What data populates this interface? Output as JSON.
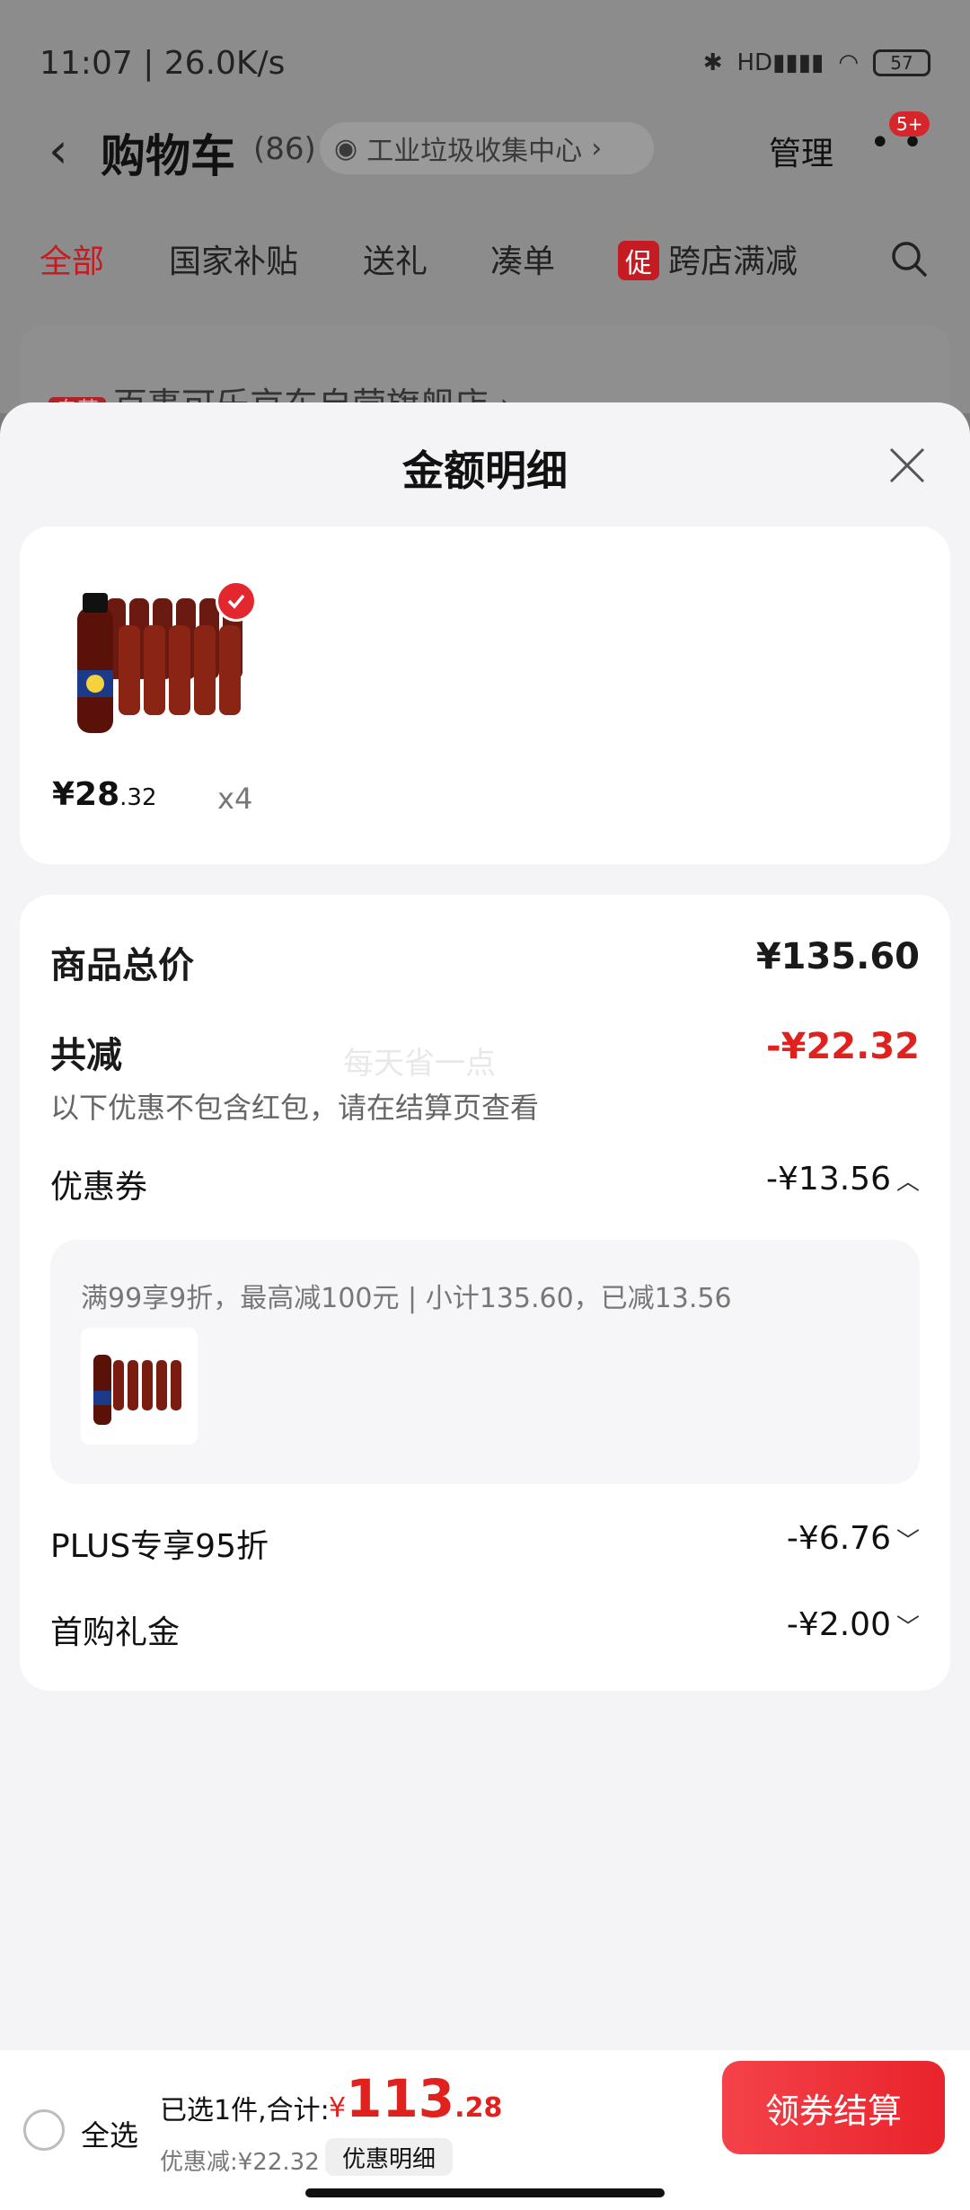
{
  "status": {
    "time_speed": "11:07 | 26.0K/s",
    "network": "HD",
    "battery": "57"
  },
  "nav": {
    "title": "购物车",
    "count": "(86)",
    "address": "工业垃圾收集中心",
    "manage": "管理",
    "badge": "5+"
  },
  "tabs": [
    {
      "label": "全部"
    },
    {
      "label": "国家补贴"
    },
    {
      "label": "送礼"
    },
    {
      "label": "凑单"
    },
    {
      "promo": "促",
      "label": "跨店满减"
    }
  ],
  "bg_store": {
    "tag": "自营",
    "name": "百事可乐京东自营旗舰店 ›"
  },
  "sheet": {
    "title": "金额明细",
    "item": {
      "price_int": "¥28",
      "price_dec": ".32",
      "qty": "x4"
    },
    "total_label": "商品总价",
    "total_value": "¥135.60",
    "reduce_label": "共减",
    "reduce_value": "-¥22.32",
    "reduce_note": "以下优惠不包含红包，请在结算页查看",
    "watermark": "每天省一点",
    "coupon_label": "优惠券",
    "coupon_value": "-¥13.56",
    "coupon_detail": "满99享9折，最高减100元 | 小计135.60，已减13.56",
    "plus_label": "PLUS专享95折",
    "plus_value": "-¥6.76",
    "gift_label": "首购礼金",
    "gift_value": "-¥2.00"
  },
  "bottom": {
    "select_all": "全选",
    "summary": "已选1件,合计:",
    "currency": "¥",
    "total_int": "113",
    "total_dec": ".28",
    "discount": "优惠减:¥22.32",
    "detail_btn": "优惠明细",
    "checkout": "领券结算"
  }
}
